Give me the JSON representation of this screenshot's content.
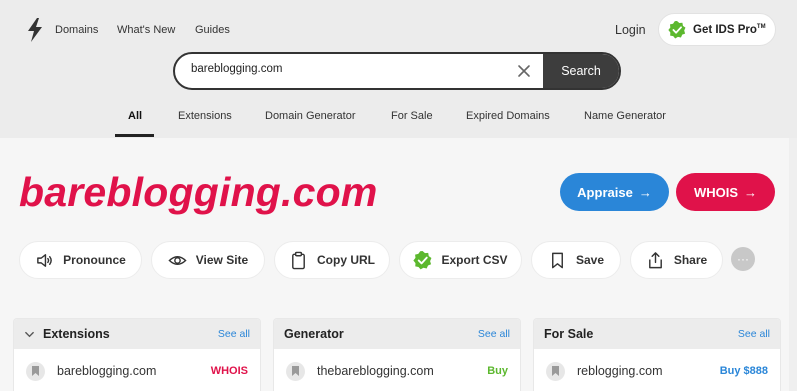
{
  "nav": {
    "links": [
      "Domains",
      "What's New",
      "Guides"
    ],
    "login": "Login",
    "pro_button": "Get IDS Pro",
    "pro_mark": "TM"
  },
  "search": {
    "value": "bareblogging.com",
    "button_label": "Search"
  },
  "tabs": [
    "All",
    "Extensions",
    "Domain Generator",
    "For Sale",
    "Expired Domains",
    "Name Generator"
  ],
  "domain": {
    "name": "bareblogging.com",
    "appraise_label": "Appraise",
    "whois_label": "WHOIS",
    "arrow": "→"
  },
  "actions": [
    "Pronounce",
    "View Site",
    "Copy URL",
    "Export CSV",
    "Save",
    "Share"
  ],
  "more_icon": "···",
  "panels": [
    {
      "title": "Extensions",
      "see_all": "See all",
      "row_domain": "bareblogging",
      "row_tld": ".com",
      "row_action": "WHOIS",
      "action_color": "#e0124a"
    },
    {
      "title": "Generator",
      "see_all": "See all",
      "row_domain": "thebareblogging",
      "row_tld": ".com",
      "row_action": "Buy",
      "action_color": "#5cb82e"
    },
    {
      "title": "For Sale",
      "see_all": "See all",
      "row_domain": "reblogging",
      "row_tld": ".com",
      "row_action": "Buy $888",
      "action_color": "#2a86d8"
    }
  ],
  "colors": {
    "brand": "#e0124a",
    "accent": "#2a86d8",
    "badge": "#5cb82e"
  }
}
